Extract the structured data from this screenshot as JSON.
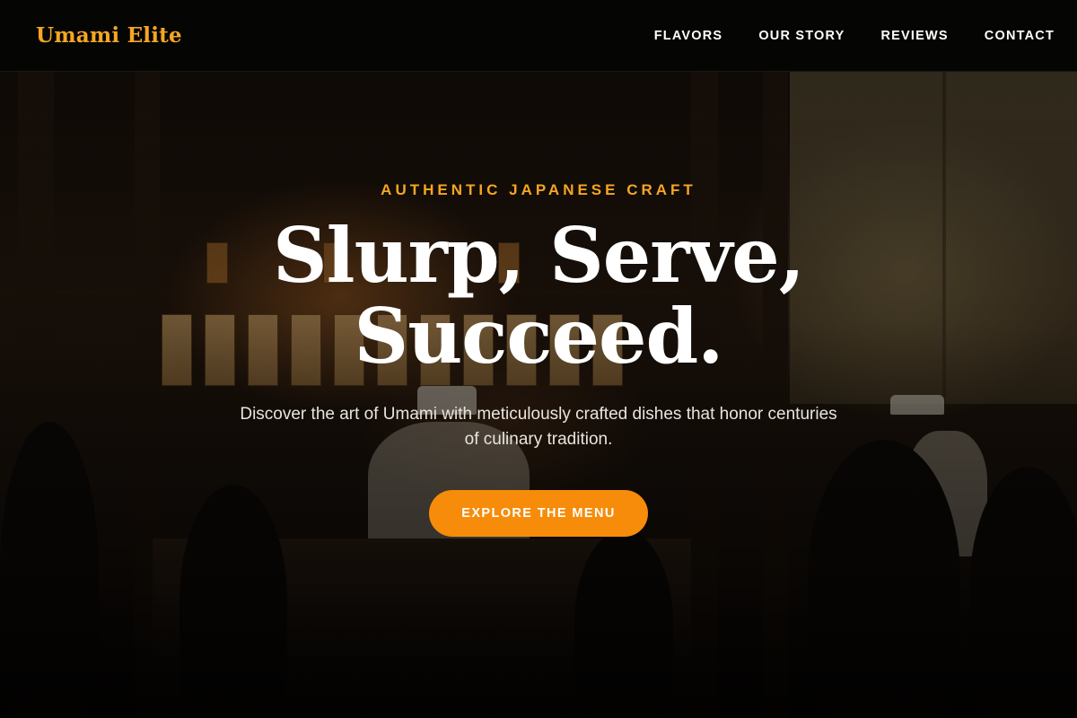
{
  "brand": {
    "logo_text": "Umami Elite",
    "accent_color": "#f5a623"
  },
  "nav": {
    "items": [
      {
        "label": "FLAVORS"
      },
      {
        "label": "OUR STORY"
      },
      {
        "label": "REVIEWS"
      },
      {
        "label": "CONTACT"
      }
    ]
  },
  "hero": {
    "eyebrow": "AUTHENTIC JAPANESE CRAFT",
    "title_line1": "Slurp, Serve,",
    "title_line2": "Succeed.",
    "subtitle": "Discover the art of Umami with meticulously crafted dishes that honor centuries of culinary tradition.",
    "cta_label": "EXPLORE THE MENU",
    "cta_color": "#f78c0a",
    "background_image": "dim restaurant interior with chefs at the counter"
  }
}
